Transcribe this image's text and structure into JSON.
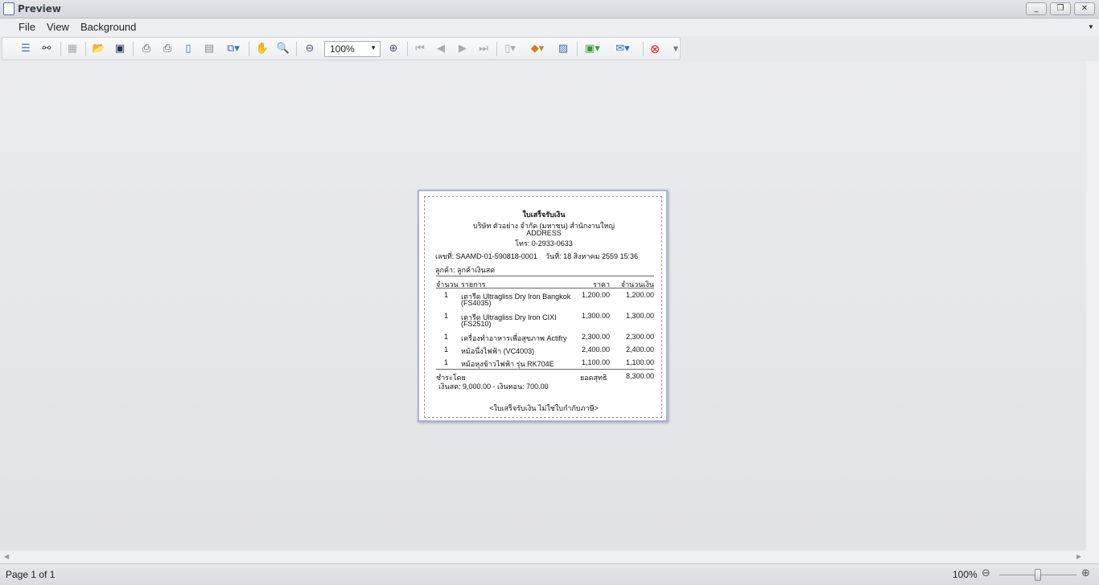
{
  "window": {
    "title": "Preview"
  },
  "menu": [
    "File",
    "View",
    "Background"
  ],
  "toolbar": {
    "zoom_value": "100%"
  },
  "receipt": {
    "title": "ใบเสร็จรับเงิน",
    "company": "บริษัท ตัวอย่าง จำกัด (มหาชน) สำนักงานใหญ่",
    "address": "ADDRESS",
    "phone": "โทร: 0-2933-0633",
    "doc_no": "เลขที่: SAAMD-01-590818-0001",
    "date": "วันที่: 18 สิงหาคม 2559 15:36",
    "customer": "ลูกค้า: ลูกค้าเงินสด",
    "headers": [
      "จำนวน",
      "รายการ",
      "ราคา",
      "จำนวนเงิน"
    ],
    "items": [
      {
        "qty": "1",
        "desc": "เตารีด Ultragliss  Dry Iron Bangkok",
        "desc2": "(FS4035)",
        "price": "1,200.00",
        "amount": "1,200.00"
      },
      {
        "qty": "1",
        "desc": "เตารีด Ultragliss  Dry Iron CIXI",
        "desc2": "(FS2510)",
        "price": "1,300.00",
        "amount": "1,300.00"
      },
      {
        "qty": "1",
        "desc": "เครื่องทำอาหารเพื่อสุขภาพ Actifry",
        "desc2": "",
        "price": "2,300.00",
        "amount": "2,300.00"
      },
      {
        "qty": "1",
        "desc": "หม้อนึ่งไฟฟ้า (VC4003)",
        "desc2": "",
        "price": "2,400.00",
        "amount": "2,400.00"
      },
      {
        "qty": "1",
        "desc": "หม้อหุงข้าวไฟฟ้า รุ่น RK704E",
        "desc2": "",
        "price": "1,100.00",
        "amount": "1,100.00"
      }
    ],
    "paid_by": "ชำระโดย",
    "total_label": "ยอดสุทธิ",
    "total": "8,300.00",
    "payment": "เงินสด: 9,000.00 - เงินทอน: 700.00",
    "footer": "<ใบเสร็จรับเงิน ไม่ใช่ใบกำกับภาษี>"
  },
  "status": {
    "page": "Page 1 of 1",
    "zoom": "100%",
    "zoom_slider_percent": 50
  }
}
